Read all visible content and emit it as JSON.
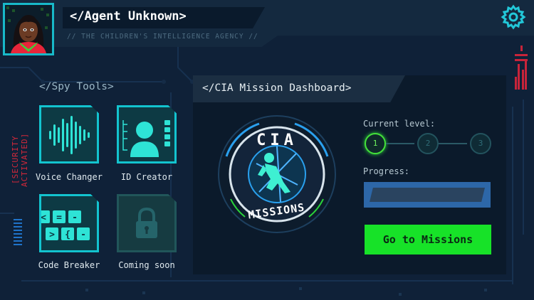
{
  "header": {
    "agent_name": "</Agent Unknown>",
    "agency": "// THE CHILDREN'S INTELLIGENCE AGENCY //"
  },
  "side": {
    "security_label": "[SECURITY ACTIVATED]"
  },
  "spy_tools": {
    "title": "</Spy Tools>",
    "items": [
      {
        "label": "Voice Changer",
        "icon": "voice-waveform-icon",
        "enabled": true
      },
      {
        "label": "ID Creator",
        "icon": "id-card-icon",
        "enabled": true
      },
      {
        "label": "Code Breaker",
        "icon": "code-keys-icon",
        "enabled": true
      },
      {
        "label": "Coming soon",
        "icon": "lock-icon",
        "enabled": false
      }
    ],
    "code_keys": [
      "<",
      "=",
      "-",
      ">",
      "{",
      "-"
    ]
  },
  "dashboard": {
    "title": "</CIA Mission Dashboard>",
    "badge_top": "CIA",
    "badge_bottom": "MISSIONS",
    "current_level_label": "Current level:",
    "levels": [
      "1",
      "2",
      "3"
    ],
    "current_level": 1,
    "progress_label": "Progress:",
    "progress": 0,
    "go_button": "Go to Missions"
  },
  "colors": {
    "accent_cyan": "#13c4cf",
    "go_green": "#17e228",
    "security_red": "#d2283a",
    "background": "#0f2138"
  }
}
